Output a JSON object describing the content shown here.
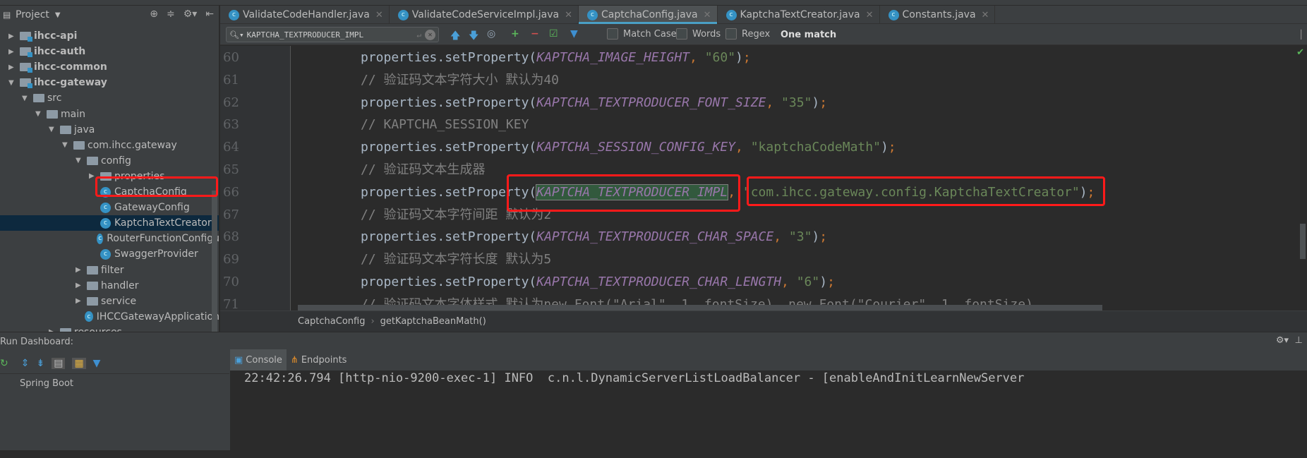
{
  "project_panel": {
    "title": "Project",
    "tree": [
      {
        "label": "ihcc-api",
        "depth": 0,
        "type": "module",
        "expanded": false,
        "bold": true
      },
      {
        "label": "ihcc-auth",
        "depth": 0,
        "type": "module",
        "expanded": false,
        "bold": true
      },
      {
        "label": "ihcc-common",
        "depth": 0,
        "type": "module",
        "expanded": false,
        "bold": true
      },
      {
        "label": "ihcc-gateway",
        "depth": 0,
        "type": "module",
        "expanded": true,
        "bold": true
      },
      {
        "label": "src",
        "depth": 1,
        "type": "folder",
        "expanded": true
      },
      {
        "label": "main",
        "depth": 2,
        "type": "folder",
        "expanded": true
      },
      {
        "label": "java",
        "depth": 3,
        "type": "folder",
        "expanded": true
      },
      {
        "label": "com.ihcc.gateway",
        "depth": 4,
        "type": "package",
        "expanded": true
      },
      {
        "label": "config",
        "depth": 5,
        "type": "package",
        "expanded": true
      },
      {
        "label": "properties",
        "depth": 6,
        "type": "package",
        "expanded": false
      },
      {
        "label": "CaptchaConfig",
        "depth": 6,
        "type": "class",
        "highlighted": true
      },
      {
        "label": "GatewayConfig",
        "depth": 6,
        "type": "class"
      },
      {
        "label": "KaptchaTextCreator",
        "depth": 6,
        "type": "class",
        "selected": true
      },
      {
        "label": "RouterFunctionConfigu",
        "depth": 6,
        "type": "class"
      },
      {
        "label": "SwaggerProvider",
        "depth": 6,
        "type": "class"
      },
      {
        "label": "filter",
        "depth": 5,
        "type": "package",
        "expanded": false
      },
      {
        "label": "handler",
        "depth": 5,
        "type": "package",
        "expanded": false
      },
      {
        "label": "service",
        "depth": 5,
        "type": "package",
        "expanded": false
      },
      {
        "label": "IHCCGatewayApplication",
        "depth": 5,
        "type": "app"
      },
      {
        "label": "resources",
        "depth": 3,
        "type": "folder",
        "expanded": false
      }
    ]
  },
  "tabs": [
    {
      "label": "ValidateCodeHandler.java",
      "active": false
    },
    {
      "label": "ValidateCodeServiceImpl.java",
      "active": false
    },
    {
      "label": "CaptchaConfig.java",
      "active": true
    },
    {
      "label": "KaptchaTextCreator.java",
      "active": false
    },
    {
      "label": "Constants.java",
      "active": false
    }
  ],
  "search": {
    "value": "KAPTCHA_TEXTPRODUCER_IMPL",
    "options": {
      "match_case": "Match Case",
      "words": "Words",
      "regex": "Regex"
    },
    "result": "One match"
  },
  "code": [
    {
      "n": "60",
      "kind": "call",
      "obj": "properties.setProperty(",
      "const": "KAPTCHA_IMAGE_HEIGHT",
      "str": "\"60\""
    },
    {
      "n": "61",
      "kind": "comment",
      "text": "// 验证码文本字符大小 默认为40"
    },
    {
      "n": "62",
      "kind": "call",
      "obj": "properties.setProperty(",
      "const": "KAPTCHA_TEXTPRODUCER_FONT_SIZE",
      "str": "\"35\""
    },
    {
      "n": "63",
      "kind": "comment",
      "text": "// KAPTCHA_SESSION_KEY"
    },
    {
      "n": "64",
      "kind": "call",
      "obj": "properties.setProperty(",
      "const": "KAPTCHA_SESSION_CONFIG_KEY",
      "str": "\"kaptchaCodeMath\""
    },
    {
      "n": "65",
      "kind": "comment",
      "text": "// 验证码文本生成器"
    },
    {
      "n": "66",
      "kind": "call",
      "obj": "properties.setProperty(",
      "const": "KAPTCHA_TEXTPRODUCER_IMPL",
      "str": "\"com.ihcc.gateway.config.KaptchaTextCreator\"",
      "match": true
    },
    {
      "n": "67",
      "kind": "comment",
      "text": "// 验证码文本字符间距 默认为2"
    },
    {
      "n": "68",
      "kind": "call",
      "obj": "properties.setProperty(",
      "const": "KAPTCHA_TEXTPRODUCER_CHAR_SPACE",
      "str": "\"3\""
    },
    {
      "n": "69",
      "kind": "comment",
      "text": "// 验证码文本字符长度 默认为5"
    },
    {
      "n": "70",
      "kind": "call",
      "obj": "properties.setProperty(",
      "const": "KAPTCHA_TEXTPRODUCER_CHAR_LENGTH",
      "str": "\"6\""
    },
    {
      "n": "71",
      "kind": "comment",
      "text": "// 验证码文本字体样式 默认为new Font(\"Arial\", 1, fontSize), new Font(\"Courier\", 1, fontSize)"
    }
  ],
  "breadcrumb": [
    "CaptchaConfig",
    "getKaptchaBeanMath()"
  ],
  "run_dashboard": {
    "title": "Run Dashboard:",
    "tabs": [
      {
        "label": "Console",
        "active": true
      },
      {
        "label": "Endpoints",
        "active": false
      }
    ],
    "tree_item": "Spring Boot",
    "console_line": "22:42:26.794 [http-nio-9200-exec-1] INFO  c.n.l.DynamicServerListLoadBalancer - [enableAndInitLearnNewServer"
  },
  "colors": {
    "highlight_box": "#ff1a1a",
    "constant": "#9876aa",
    "string": "#6a8759",
    "comment": "#808080",
    "selection": "#0d293e"
  }
}
